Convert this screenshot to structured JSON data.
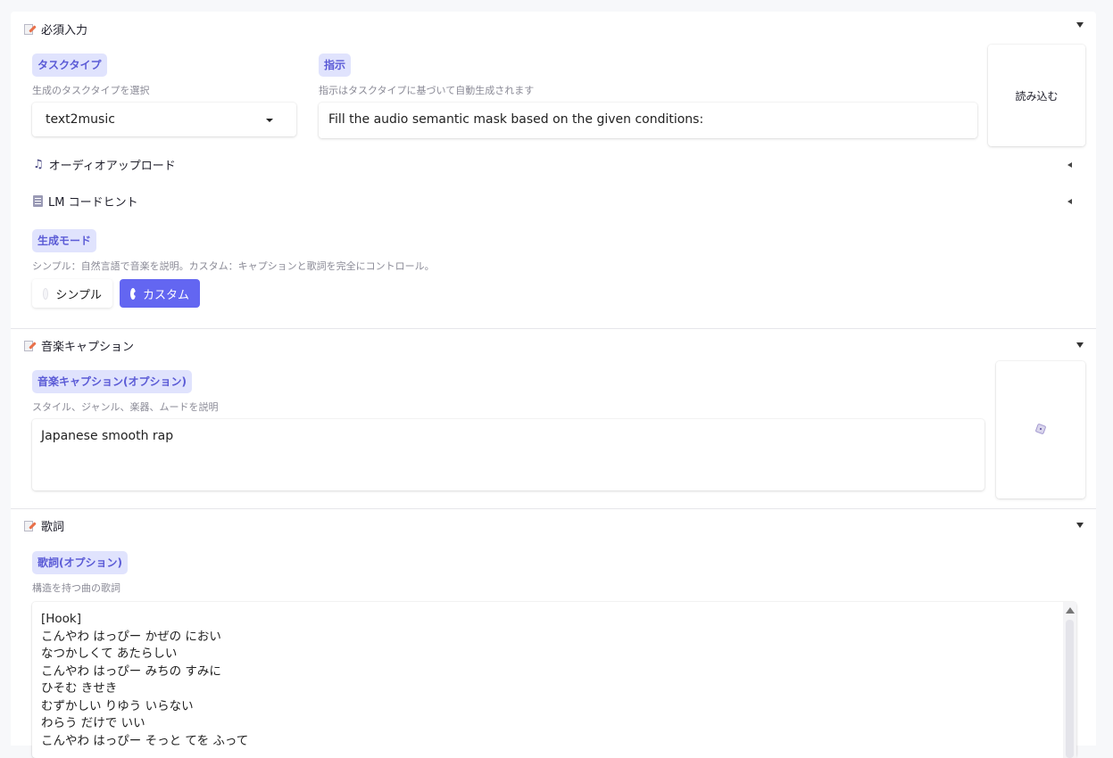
{
  "sections": {
    "required": {
      "title": "必須入力",
      "icon": "memo-icon",
      "task_type": {
        "label": "タスクタイプ",
        "hint": "生成のタスクタイプを選択",
        "value": "text2music"
      },
      "instruction": {
        "label": "指示",
        "hint": "指示はタスクタイプに基づいて自動生成されます",
        "value": "Fill the audio semantic mask based on the given conditions:"
      },
      "load_button": "読み込む",
      "audio_upload": {
        "title": "オーディオアップロード",
        "icon": "musical-note-icon"
      },
      "lm_hint": {
        "title": "LM コードヒント",
        "icon": "musical-score-icon"
      },
      "mode": {
        "label": "生成モード",
        "hint": "シンプル：自然言語で音楽を説明。カスタム：キャプションと歌詞を完全にコントロール。",
        "options": [
          "シンプル",
          "カスタム"
        ],
        "selected": "カスタム"
      }
    },
    "caption": {
      "title": "音楽キャプション",
      "icon": "memo-icon",
      "label": "音楽キャプション(オプション)",
      "hint": "スタイル、ジャンル、楽器、ムードを説明",
      "value": "Japanese smooth rap",
      "random_button_icon": "dice-icon"
    },
    "lyrics": {
      "title": "歌詞",
      "icon": "memo-icon",
      "label": "歌詞(オプション)",
      "hint": "構造を持つ曲の歌詞",
      "value": "[Hook]\nこんやわ はっぴー かぜの におい\nなつかしくて あたらしい\nこんやわ はっぴー みちの すみに\nひそむ きせき\nむずかしい りゆう いらない\nわらう だけで いい\nこんやわ はっぴー そっと てを ふって"
    }
  },
  "colors": {
    "accent": "#6366f1",
    "badge_bg": "#e0e3fd",
    "badge_text": "#5b5bd6"
  }
}
